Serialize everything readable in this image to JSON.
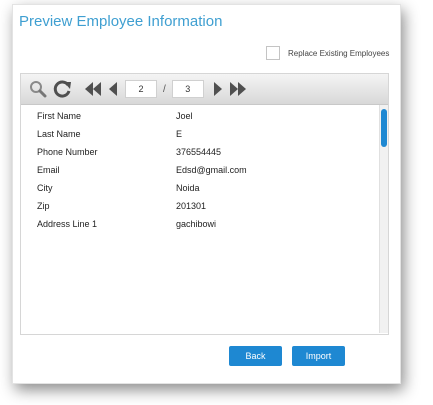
{
  "dialog": {
    "title": "Preview Employee Information",
    "replace_existing_label": "Replace Existing Employees",
    "replace_existing_checked": false
  },
  "toolbar": {
    "search_icon": "search-icon",
    "refresh_icon": "refresh-icon",
    "first_icon": "first-page-icon",
    "prev_icon": "prev-page-icon",
    "next_icon": "next-page-icon",
    "last_icon": "last-page-icon",
    "current_page": "2",
    "separator": "/",
    "total_pages": "3"
  },
  "record": [
    {
      "label": "First Name",
      "value": "Joel"
    },
    {
      "label": "Last Name",
      "value": "E"
    },
    {
      "label": "Phone Number",
      "value": "376554445"
    },
    {
      "label": "Email",
      "value": "Edsd@gmail.com"
    },
    {
      "label": "City",
      "value": "Noida"
    },
    {
      "label": "Zip",
      "value": "201301"
    },
    {
      "label": "Address Line 1",
      "value": "gachibowi"
    }
  ],
  "buttons": {
    "back": "Back",
    "import": "Import"
  },
  "colors": {
    "accent": "#1e88d2",
    "title": "#3f9fd1"
  }
}
